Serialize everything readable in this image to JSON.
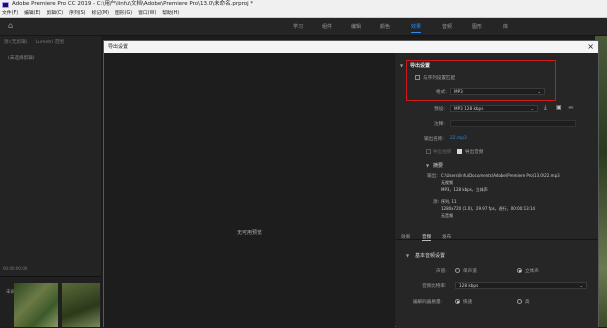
{
  "titlebar": {
    "title": "Adobe Premiere Pro CC 2019 - C:\\用户\\linfu\\文档\\Adobe\\Premiere Pro\\13.0\\未命名.prproj *"
  },
  "menubar": {
    "items": [
      "文件(F)",
      "编辑(E)",
      "剪辑(C)",
      "序列(S)",
      "标记(M)",
      "图形(G)",
      "窗口(W)",
      "帮助(H)"
    ]
  },
  "workspace_tabs": [
    "学习",
    "组件",
    "编辑",
    "颜色",
    "效果",
    "音频",
    "图形",
    "库"
  ],
  "workspace_active": "效果",
  "left_panel": {
    "tabs": [
      "源:(无剪辑)",
      "Lumetri 范围"
    ],
    "no_clip": "(未选择剪辑)",
    "timecode": "00:00:00:00",
    "project_title": "未命名.prproj"
  },
  "dialog": {
    "title": "导出设置",
    "no_preview": "无可用预览",
    "export_settings_header": "导出设置",
    "match_sequence": "与序列设置匹配",
    "format_label": "格式:",
    "format_value": "MP3",
    "preset_label": "预设:",
    "preset_value": "MP3 128 kbps",
    "comment_label": "注释:",
    "output_name_label": "输出名称:",
    "output_name_value": "22.mp3",
    "export_video": "导出视频",
    "export_audio": "导出音频",
    "summary_header": "摘要",
    "output_label": "输出:",
    "output_path": "C:\\Users\\linfu\\Documents\\Adobe\\Premiere Pro\\13.0\\22.mp3",
    "output_line2": "无视频",
    "output_line3": "MP3，128 kbps，立体声",
    "source_label": "源:",
    "source_line1": "序列, 11",
    "source_line2": "1280x720 (1.0)，29.97 fps，逐行，00:00:13:14",
    "source_line3": "无音频",
    "tabs": [
      "效果",
      "音频",
      "发布"
    ],
    "tab_active": "音频",
    "basic_audio_header": "基本音频设置",
    "channels_label": "声道:",
    "mono": "单声道",
    "stereo": "立体声",
    "bitrate_label": "音频比特率:",
    "bitrate_value": "128 kbps",
    "encoder_quality_label": "编解码器质量:",
    "fast": "快速",
    "high": "高"
  },
  "colors": {
    "accent": "#2d8ceb",
    "highlight_box": "#d01818",
    "dialog_bg": "#232323"
  }
}
